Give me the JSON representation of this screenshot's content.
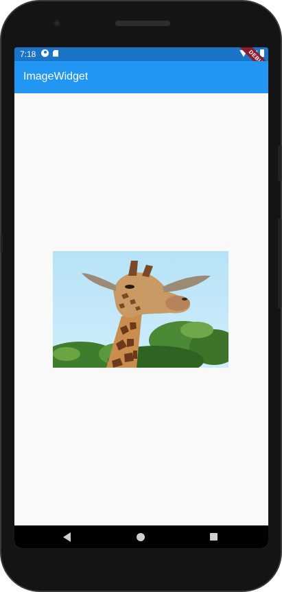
{
  "status_bar": {
    "time": "7:18",
    "background_color": "#1a75c8",
    "icons_left": [
      "media-icon",
      "sd-card-icon"
    ],
    "icons_right": [
      "wifi-icon",
      "signal-icon",
      "battery-icon"
    ]
  },
  "debug_banner": {
    "label": "DEBUG",
    "color": "#8f1b2b"
  },
  "app_bar": {
    "title": "ImageWidget",
    "color": "#2196f3"
  },
  "content": {
    "image_alt": "giraffe-photo",
    "background_color": "#f9f9f9"
  },
  "nav_bar": {
    "buttons": [
      "back-icon",
      "home-icon",
      "recents-icon"
    ]
  }
}
